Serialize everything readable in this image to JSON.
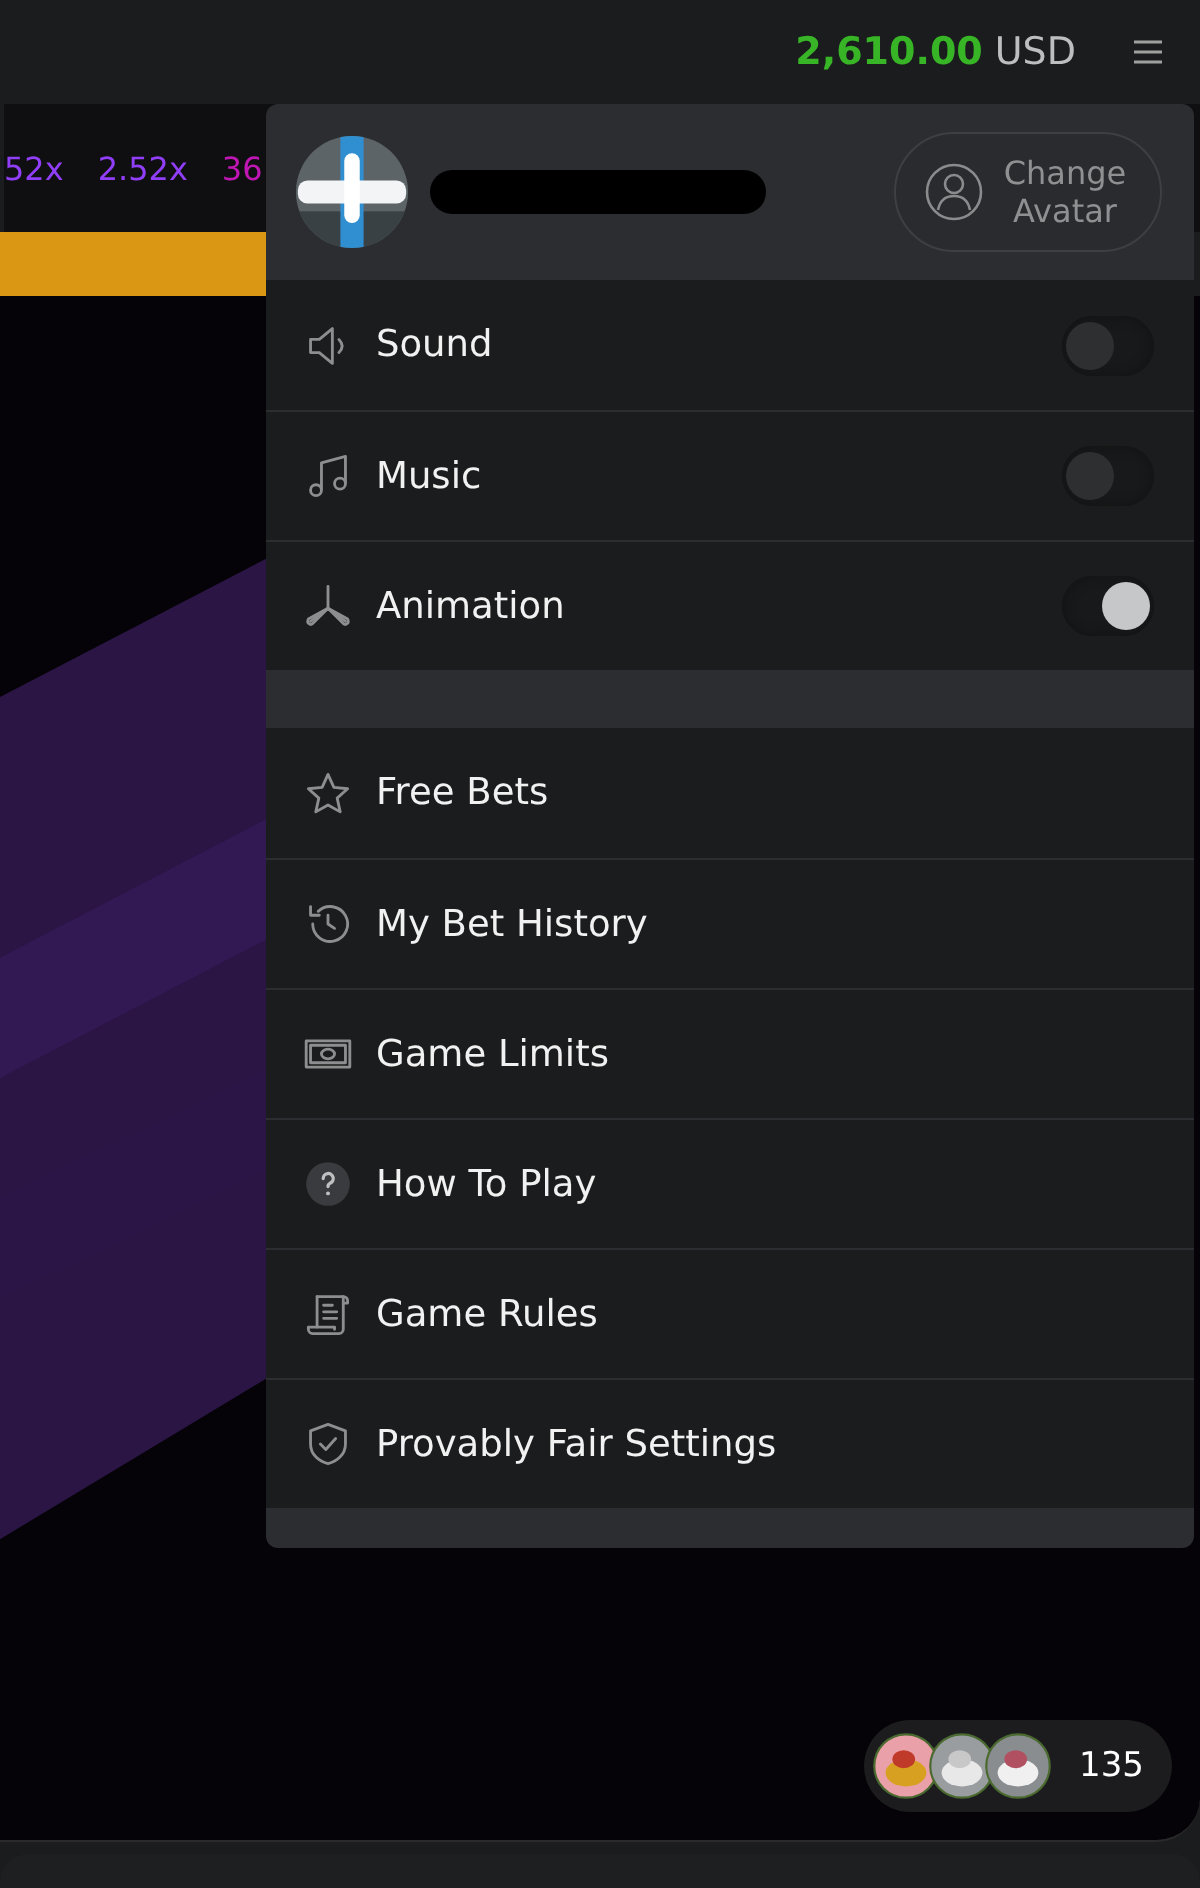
{
  "header": {
    "balance": "2,610.00",
    "currency": "USD"
  },
  "multipliers": [
    {
      "value": "52x",
      "color": "#913ef8"
    },
    {
      "value": "2.52x",
      "color": "#913ef8"
    },
    {
      "value": "36",
      "color": "#c017b4"
    }
  ],
  "menu": {
    "change_avatar": "Change Avatar",
    "toggles": [
      {
        "kind": "sound",
        "label": "Sound",
        "on": false
      },
      {
        "kind": "music",
        "label": "Music",
        "on": false
      },
      {
        "kind": "animation",
        "label": "Animation",
        "on": true
      }
    ],
    "items": [
      {
        "kind": "star",
        "label": "Free Bets"
      },
      {
        "kind": "history",
        "label": "My Bet History"
      },
      {
        "kind": "money",
        "label": "Game Limits"
      },
      {
        "kind": "help",
        "label": "How To Play"
      },
      {
        "kind": "rules",
        "label": "Game Rules"
      },
      {
        "kind": "shield",
        "label": "Provably Fair Settings"
      }
    ]
  },
  "online": {
    "count": "135"
  }
}
